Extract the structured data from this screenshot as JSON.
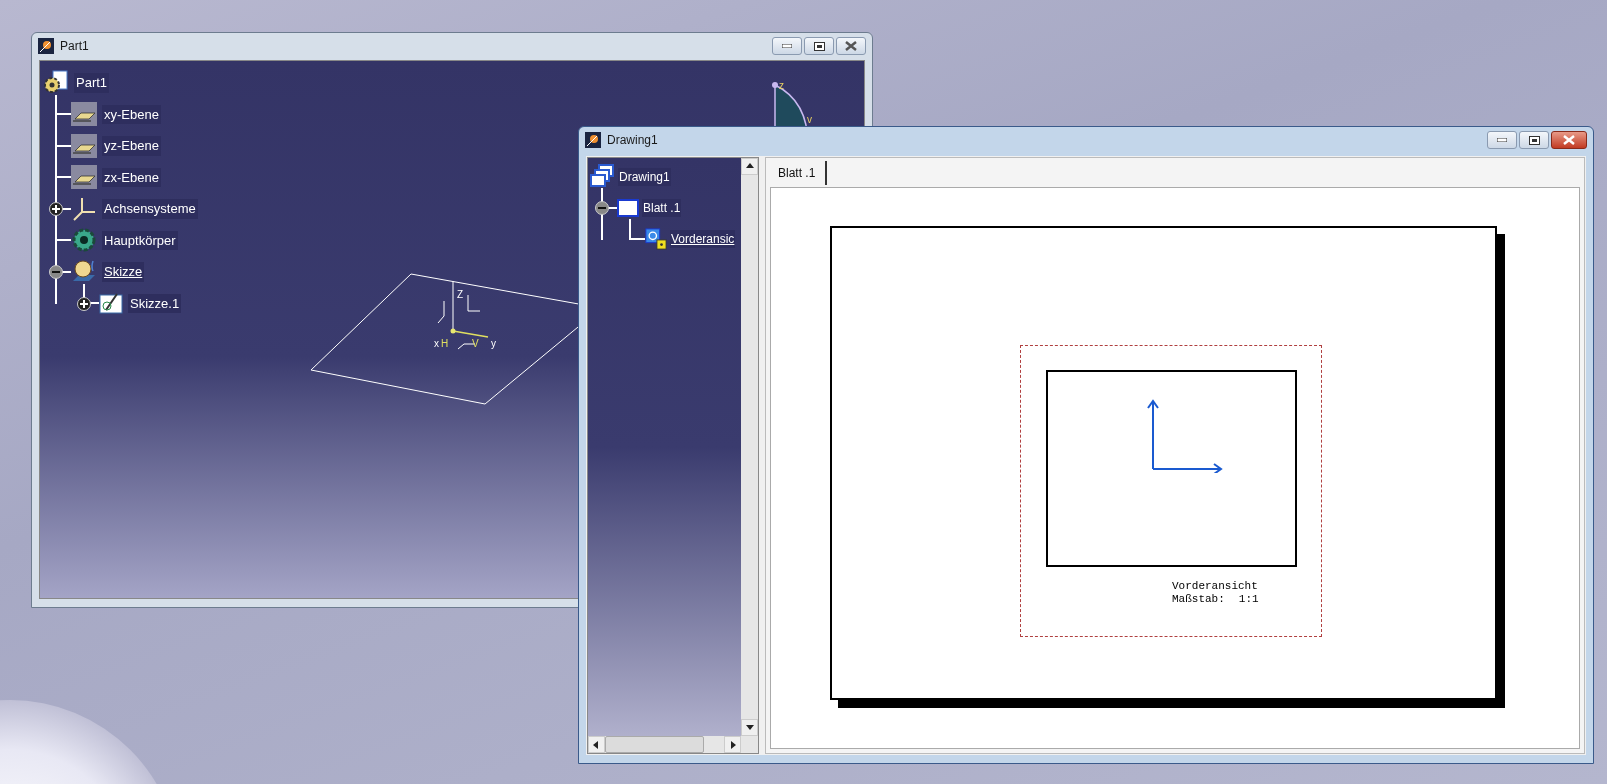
{
  "part_window": {
    "title": "Part1",
    "active": false,
    "tree": {
      "label": "Part1",
      "kind": "part",
      "children": [
        {
          "label": "xy-Ebene",
          "kind": "plane"
        },
        {
          "label": "yz-Ebene",
          "kind": "plane"
        },
        {
          "label": "zx-Ebene",
          "kind": "plane"
        },
        {
          "label": "Achsensysteme",
          "kind": "axis",
          "expanded": false
        },
        {
          "label": "Hauptkörper",
          "kind": "body"
        },
        {
          "label": "Skizze",
          "kind": "sketch",
          "expanded": true,
          "current": true,
          "children": [
            {
              "label": "Skizze.1",
              "kind": "sketch_item",
              "expanded": false
            }
          ]
        }
      ]
    },
    "axis_labels": [
      "Z",
      "x",
      "H",
      "V",
      "y"
    ],
    "compass_labels": [
      "z",
      "v"
    ]
  },
  "drawing_window": {
    "title": "Drawing1",
    "active": true,
    "tree": {
      "label": "Drawing1",
      "kind": "drawing",
      "children": [
        {
          "label": "Blatt .1",
          "kind": "sheet",
          "expanded": true,
          "children": [
            {
              "label": "Vorderansic",
              "kind": "view",
              "current": true
            }
          ]
        }
      ]
    },
    "tabs": [
      {
        "label": "Blatt .1",
        "selected": true
      }
    ],
    "view": {
      "name": "Vorderansicht",
      "scale_label": "Maßstab:",
      "scale": "1:1"
    }
  }
}
